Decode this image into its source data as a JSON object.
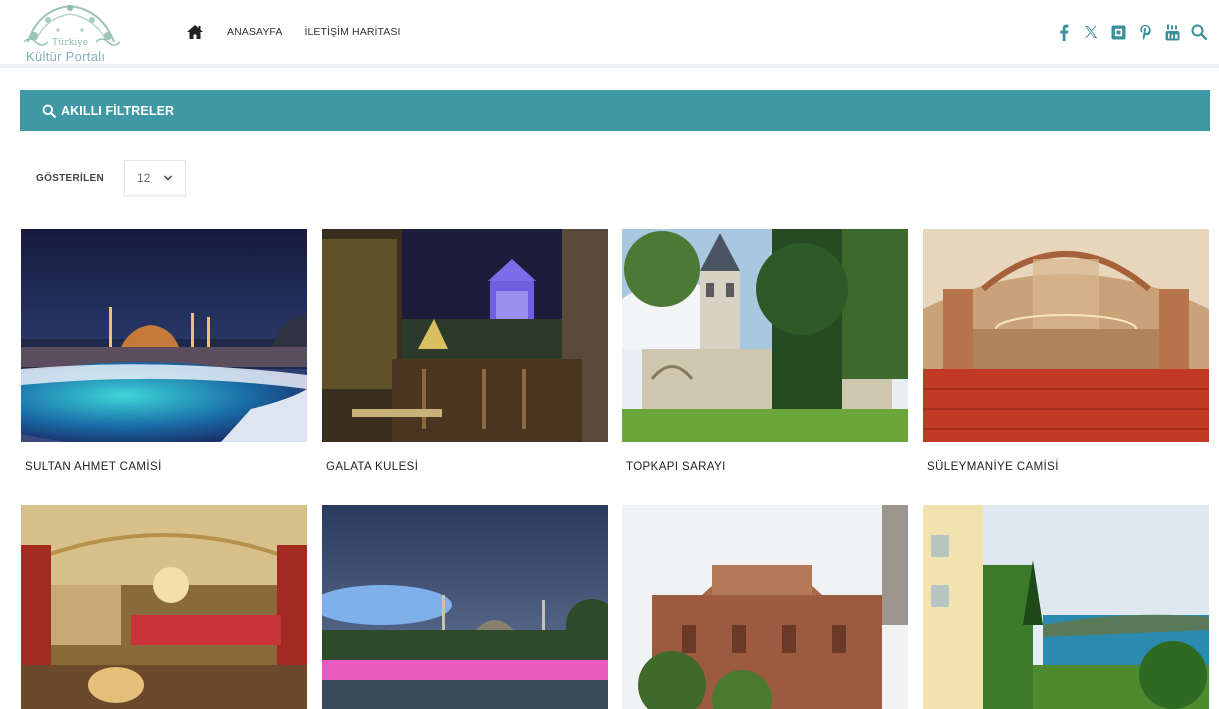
{
  "logo": {
    "line1": "Türkiye",
    "line2": "Kültür Portalı"
  },
  "nav": {
    "home_label": "ANASAYFA",
    "map_label": "İLETİŞİM HARİTASI"
  },
  "social": [
    "facebook-icon",
    "x-icon",
    "instagram-icon",
    "pinterest-icon",
    "youtube-icon",
    "search-icon"
  ],
  "colors": {
    "accent": "#3f98a3",
    "icon": "#3b8f9c"
  },
  "filters": {
    "title": "AKILLI FİLTRELER"
  },
  "showing": {
    "label": "GÖSTERİLEN",
    "value": "12"
  },
  "cards": [
    {
      "title": "SULTAN AHMET CAMİSİ"
    },
    {
      "title": "GALATA KULESİ"
    },
    {
      "title": "TOPKAPI SARAYI"
    },
    {
      "title": "SÜLEYMANİYE CAMİSİ"
    },
    {
      "title": ""
    },
    {
      "title": ""
    },
    {
      "title": ""
    },
    {
      "title": ""
    }
  ]
}
